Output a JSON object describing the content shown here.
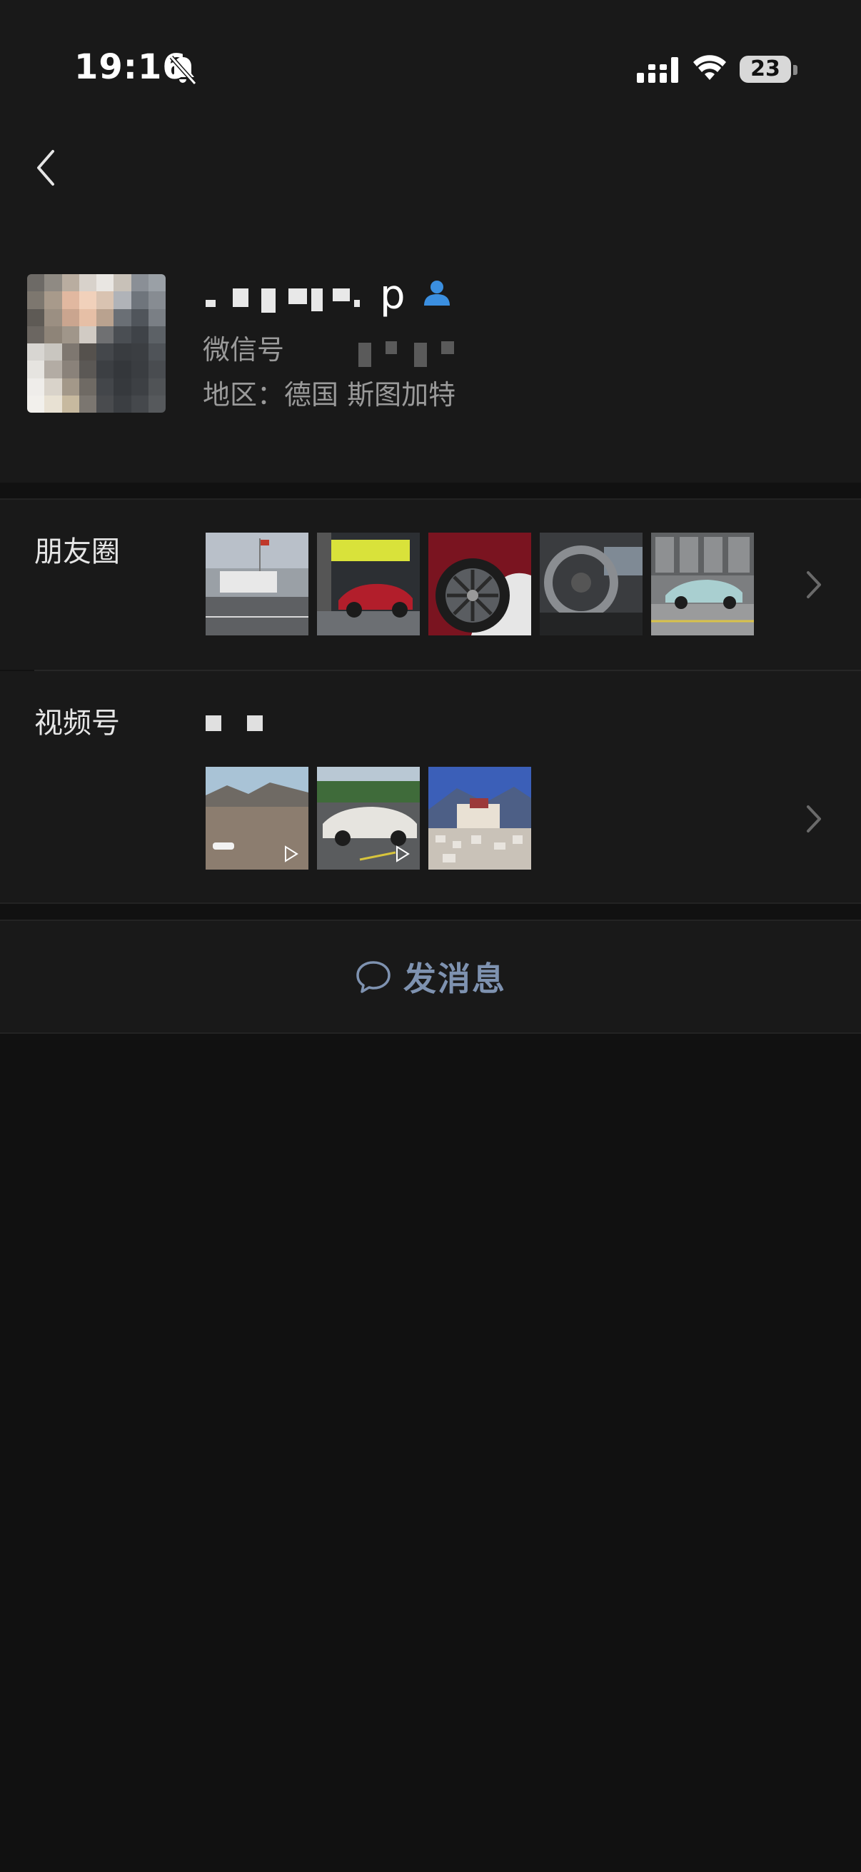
{
  "status_bar": {
    "time": "19:16",
    "battery": "23",
    "icons": [
      "bell-slash-icon",
      "signal-icon",
      "wifi-icon",
      "battery-icon"
    ]
  },
  "nav": {
    "back_icon": "chevron-left-icon"
  },
  "profile": {
    "name_visible_tail": "p",
    "wechat_id_label": "微信号",
    "region": "地区：德国 斯图加特",
    "contact_icon": "person-icon"
  },
  "moments": {
    "label": "朋友圈",
    "thumbnails": [
      "factory-building",
      "red-sports-car",
      "red-car-wheel",
      "steering-wheel",
      "green-ev-car"
    ]
  },
  "channels": {
    "label": "视频号",
    "thumbnails": [
      "desert-car",
      "white-car-parking",
      "mountain-palace"
    ]
  },
  "actions": {
    "send_message": "发消息",
    "send_message_icon": "chat-bubble-icon"
  },
  "colors": {
    "background": "#111111",
    "panel": "#191919",
    "accent_link": "#7e92b0",
    "contact_icon": "#3b8fe0"
  }
}
